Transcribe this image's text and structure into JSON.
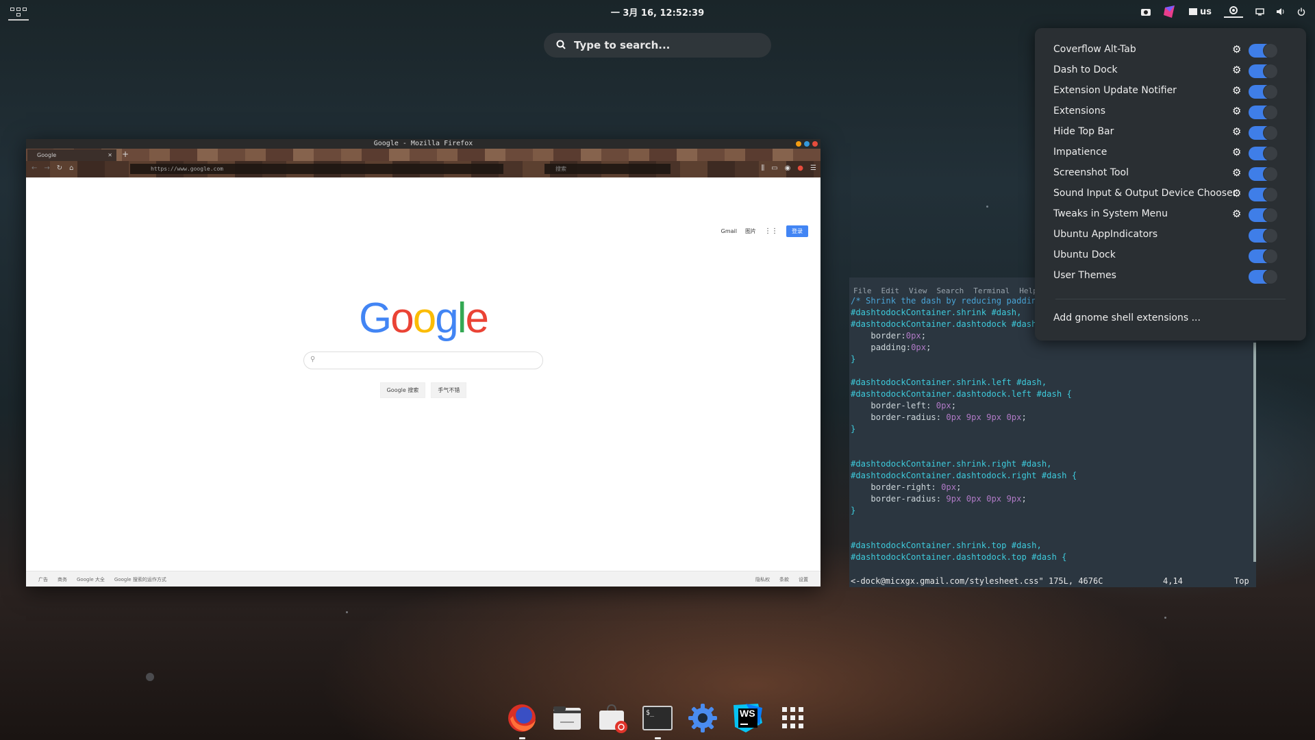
{
  "topbar": {
    "clock": "一 3月 16, 12:52:39",
    "keyboard_layout": "us"
  },
  "search": {
    "placeholder": "Type to search..."
  },
  "firefox": {
    "window_title": "Google - Mozilla Firefox",
    "tab_label": "Google",
    "url": "https://www.google.com",
    "search_placeholder": "搜索",
    "google": {
      "links": [
        "Gmail",
        "图片"
      ],
      "signin": "登录",
      "logo_text": "Google",
      "logo_colors": [
        "#4285f4",
        "#ea4335",
        "#fbbc05",
        "#4285f4",
        "#34a853",
        "#ea4335"
      ],
      "btn_search": "Google 搜索",
      "btn_lucky": "手气不错",
      "footer_left": [
        "广告",
        "商务",
        "Google 大全",
        "Google 搜索的运作方式"
      ],
      "footer_right": [
        "隐私权",
        "条款",
        "设置"
      ]
    }
  },
  "terminal": {
    "menu": [
      "File",
      "Edit",
      "View",
      "Search",
      "Terminal",
      "Help"
    ],
    "status_file": "<-dock@micxgx.gmail.com/stylesheet.css\" 175L, 4676C",
    "status_pos": "4,14",
    "status_scroll": "Top"
  },
  "extensions_menu": {
    "items": [
      {
        "name": "Coverflow Alt-Tab",
        "has_settings": true,
        "enabled": true
      },
      {
        "name": "Dash to Dock",
        "has_settings": true,
        "enabled": true
      },
      {
        "name": "Extension Update Notifier",
        "has_settings": true,
        "enabled": true
      },
      {
        "name": "Extensions",
        "has_settings": true,
        "enabled": true
      },
      {
        "name": "Hide Top Bar",
        "has_settings": true,
        "enabled": true
      },
      {
        "name": "Impatience",
        "has_settings": true,
        "enabled": true
      },
      {
        "name": "Screenshot Tool",
        "has_settings": true,
        "enabled": true
      },
      {
        "name": "Sound Input & Output Device Chooser",
        "has_settings": true,
        "enabled": true
      },
      {
        "name": "Tweaks in System Menu",
        "has_settings": true,
        "enabled": true
      },
      {
        "name": "Ubuntu AppIndicators",
        "has_settings": false,
        "enabled": true
      },
      {
        "name": "Ubuntu Dock",
        "has_settings": false,
        "enabled": true
      },
      {
        "name": "User Themes",
        "has_settings": false,
        "enabled": true
      }
    ],
    "add_label": "Add gnome shell extensions ...",
    "accent": "#3f7ee8"
  },
  "dock": {
    "apps": [
      "firefox-icon",
      "files-icon",
      "software-center-icon",
      "terminal-icon",
      "settings-icon",
      "webstorm-icon",
      "app-grid-icon"
    ],
    "webstorm_label": "WS",
    "terminal_label": "$_"
  }
}
